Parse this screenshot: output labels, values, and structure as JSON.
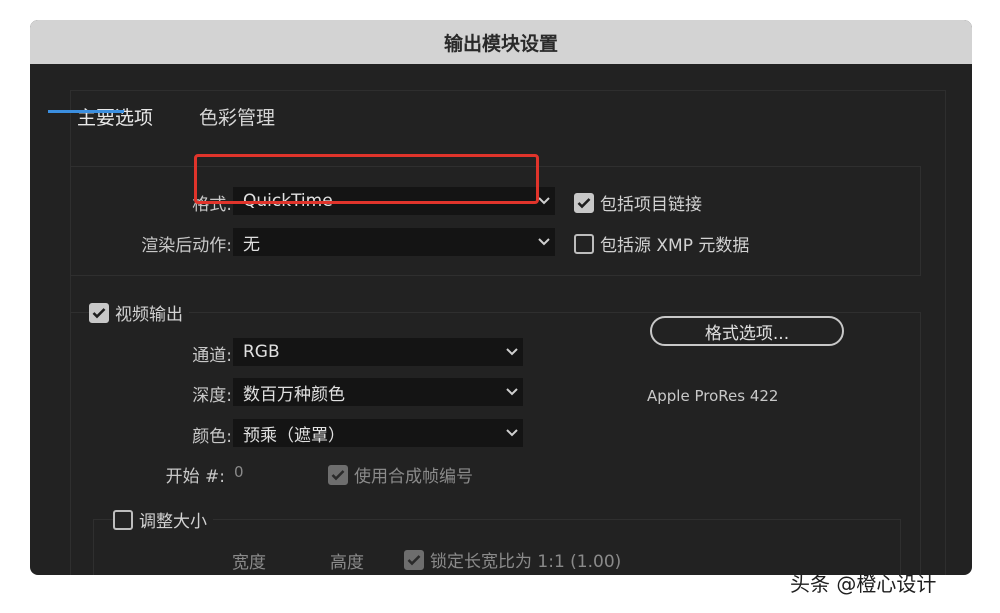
{
  "window": {
    "title": "输出模块设置"
  },
  "tabs": [
    {
      "label": "主要选项",
      "active": true
    },
    {
      "label": "色彩管理",
      "active": false
    }
  ],
  "format": {
    "label": "格式:",
    "value": "QuickTime",
    "include_project_link": {
      "label": "包括项目链接",
      "checked": true
    }
  },
  "post_render": {
    "label": "渲染后动作:",
    "value": "无",
    "include_xmp": {
      "label": "包括源 XMP 元数据",
      "checked": false
    }
  },
  "video_output": {
    "label": "视频输出",
    "checked": true,
    "channels": {
      "label": "通道:",
      "value": "RGB"
    },
    "depth": {
      "label": "深度:",
      "value": "数百万种颜色"
    },
    "color": {
      "label": "颜色:",
      "value": "预乘（遮罩）"
    },
    "start": {
      "label": "开始 #:",
      "value": "0"
    },
    "use_comp_frame": {
      "label": "使用合成帧编号",
      "checked": true
    },
    "format_options_button": "格式选项...",
    "codec_info": "Apple ProRes 422"
  },
  "resize": {
    "label": "调整大小",
    "checked": false,
    "width_label": "宽度",
    "height_label": "高度",
    "lock_aspect": {
      "label": "锁定长宽比为 1:1 (1.00)",
      "checked": true
    }
  },
  "watermark": "头条 @橙心设计",
  "colors": {
    "highlight": "#e0342b",
    "tab_underline": "#3b8fe0"
  }
}
